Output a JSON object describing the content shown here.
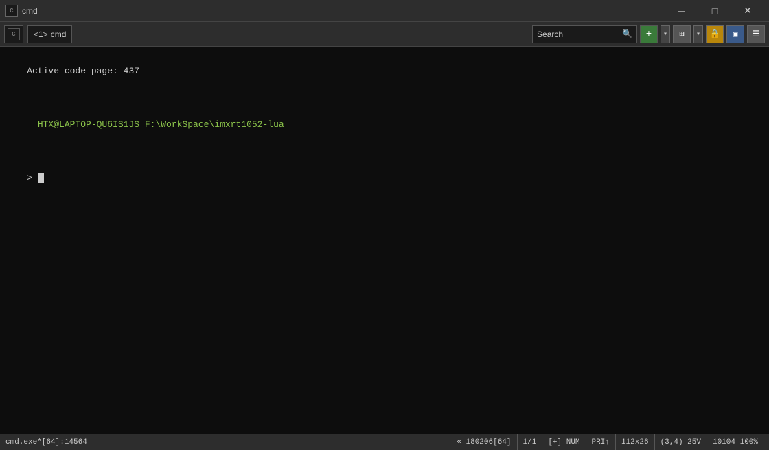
{
  "titlebar": {
    "icon_label": "C",
    "title": "cmd",
    "minimize_label": "─",
    "maximize_label": "□",
    "close_label": "✕"
  },
  "toolbar": {
    "tab_icon": "C",
    "tab_number": "<1>",
    "tab_title": "cmd",
    "search_placeholder": "Search",
    "search_value": "Search",
    "add_label": "+",
    "chevron_label": "▾",
    "grid_label": "⊞",
    "lock_label": "🔒",
    "panels_label": "▣",
    "menu_label": "☰"
  },
  "terminal": {
    "line1": "Active code page: 437",
    "line2_user": "HTX@LAPTOP-QU6IS1JS",
    "line2_path": " F:\\WorkSpace\\imxrt1052-lua",
    "prompt_symbol": "> "
  },
  "statusbar": {
    "left": "cmd.exe*[64]:14564",
    "pos1": "« 180206[64]",
    "pos2": "1/1",
    "pos3": "[+] NUM",
    "pos4": "PRI↑",
    "pos5": "112x26",
    "pos6": "(3,4) 25V",
    "pos7": "10104 100%"
  }
}
